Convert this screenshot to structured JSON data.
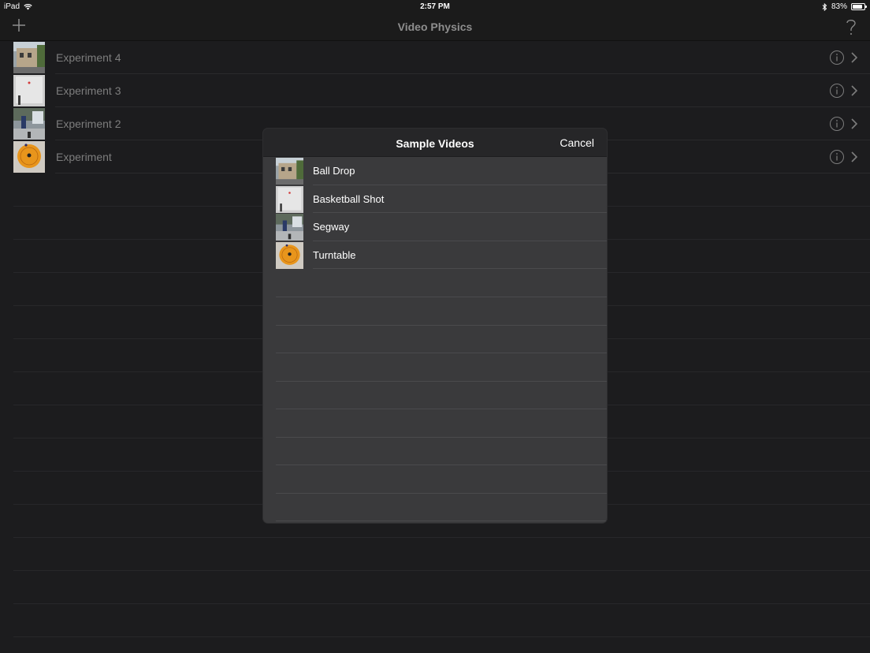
{
  "status_bar": {
    "device": "iPad",
    "time": "2:57 PM",
    "battery": "83%",
    "battery_level": 0.83
  },
  "nav": {
    "title": "Video Physics",
    "add_icon": "plus-icon",
    "help_icon": "question-icon"
  },
  "experiments": [
    {
      "label": "Experiment 4",
      "thumb": "building"
    },
    {
      "label": "Experiment 3",
      "thumb": "wall"
    },
    {
      "label": "Experiment 2",
      "thumb": "street"
    },
    {
      "label": "Experiment",
      "thumb": "turntable"
    }
  ],
  "modal": {
    "title": "Sample Videos",
    "cancel_label": "Cancel",
    "items": [
      {
        "label": "Ball Drop",
        "thumb": "building"
      },
      {
        "label": "Basketball Shot",
        "thumb": "wall"
      },
      {
        "label": "Segway",
        "thumb": "street"
      },
      {
        "label": "Turntable",
        "thumb": "turntable"
      }
    ]
  },
  "colors": {
    "background": "#1c1c1e",
    "bar": "#1b1b1b",
    "modal": "#3a3a3c",
    "modal_header": "#262628",
    "turntable_orange": "#e8951c"
  }
}
